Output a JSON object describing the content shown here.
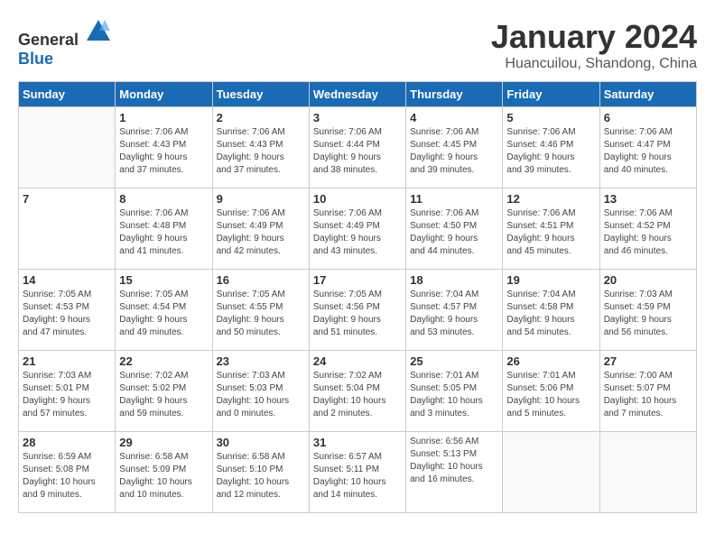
{
  "logo": {
    "text_general": "General",
    "text_blue": "Blue"
  },
  "title": "January 2024",
  "subtitle": "Huancuilou, Shandong, China",
  "days_of_week": [
    "Sunday",
    "Monday",
    "Tuesday",
    "Wednesday",
    "Thursday",
    "Friday",
    "Saturday"
  ],
  "weeks": [
    [
      {
        "day": "",
        "info": ""
      },
      {
        "day": "1",
        "info": "Sunrise: 7:06 AM\nSunset: 4:43 PM\nDaylight: 9 hours\nand 37 minutes."
      },
      {
        "day": "2",
        "info": "Sunrise: 7:06 AM\nSunset: 4:43 PM\nDaylight: 9 hours\nand 37 minutes."
      },
      {
        "day": "3",
        "info": "Sunrise: 7:06 AM\nSunset: 4:44 PM\nDaylight: 9 hours\nand 38 minutes."
      },
      {
        "day": "4",
        "info": "Sunrise: 7:06 AM\nSunset: 4:45 PM\nDaylight: 9 hours\nand 39 minutes."
      },
      {
        "day": "5",
        "info": "Sunrise: 7:06 AM\nSunset: 4:46 PM\nDaylight: 9 hours\nand 39 minutes."
      },
      {
        "day": "6",
        "info": "Sunrise: 7:06 AM\nSunset: 4:47 PM\nDaylight: 9 hours\nand 40 minutes."
      }
    ],
    [
      {
        "day": "7",
        "info": ""
      },
      {
        "day": "8",
        "info": "Sunrise: 7:06 AM\nSunset: 4:48 PM\nDaylight: 9 hours\nand 41 minutes."
      },
      {
        "day": "9",
        "info": "Sunrise: 7:06 AM\nSunset: 4:49 PM\nDaylight: 9 hours\nand 42 minutes."
      },
      {
        "day": "10",
        "info": "Sunrise: 7:06 AM\nSunset: 4:49 PM\nDaylight: 9 hours\nand 43 minutes."
      },
      {
        "day": "11",
        "info": "Sunrise: 7:06 AM\nSunset: 4:50 PM\nDaylight: 9 hours\nand 44 minutes."
      },
      {
        "day": "12",
        "info": "Sunrise: 7:06 AM\nSunset: 4:51 PM\nDaylight: 9 hours\nand 45 minutes."
      },
      {
        "day": "13",
        "info": "Sunrise: 7:06 AM\nSunset: 4:52 PM\nDaylight: 9 hours\nand 46 minutes."
      }
    ],
    [
      {
        "day": "14",
        "info": "Sunrise: 7:05 AM\nSunset: 4:53 PM\nDaylight: 9 hours\nand 47 minutes."
      },
      {
        "day": "15",
        "info": "Sunrise: 7:05 AM\nSunset: 4:54 PM\nDaylight: 9 hours\nand 49 minutes."
      },
      {
        "day": "16",
        "info": "Sunrise: 7:05 AM\nSunset: 4:55 PM\nDaylight: 9 hours\nand 50 minutes."
      },
      {
        "day": "17",
        "info": "Sunrise: 7:05 AM\nSunset: 4:56 PM\nDaylight: 9 hours\nand 51 minutes."
      },
      {
        "day": "18",
        "info": "Sunrise: 7:04 AM\nSunset: 4:57 PM\nDaylight: 9 hours\nand 53 minutes."
      },
      {
        "day": "19",
        "info": "Sunrise: 7:04 AM\nSunset: 4:58 PM\nDaylight: 9 hours\nand 54 minutes."
      },
      {
        "day": "20",
        "info": "Sunrise: 7:03 AM\nSunset: 4:59 PM\nDaylight: 9 hours\nand 56 minutes."
      }
    ],
    [
      {
        "day": "21",
        "info": "Sunrise: 7:03 AM\nSunset: 5:01 PM\nDaylight: 9 hours\nand 57 minutes."
      },
      {
        "day": "22",
        "info": "Sunrise: 7:02 AM\nSunset: 5:02 PM\nDaylight: 9 hours\nand 59 minutes."
      },
      {
        "day": "23",
        "info": "Sunrise: 7:03 AM\nSunset: 5:03 PM\nDaylight: 10 hours\nand 0 minutes."
      },
      {
        "day": "24",
        "info": "Sunrise: 7:02 AM\nSunset: 5:04 PM\nDaylight: 10 hours\nand 2 minutes."
      },
      {
        "day": "25",
        "info": "Sunrise: 7:01 AM\nSunset: 5:05 PM\nDaylight: 10 hours\nand 3 minutes."
      },
      {
        "day": "26",
        "info": "Sunrise: 7:01 AM\nSunset: 5:06 PM\nDaylight: 10 hours\nand 5 minutes."
      },
      {
        "day": "27",
        "info": "Sunrise: 7:00 AM\nSunset: 5:07 PM\nDaylight: 10 hours\nand 7 minutes."
      }
    ],
    [
      {
        "day": "28",
        "info": "Sunrise: 6:59 AM\nSunset: 5:08 PM\nDaylight: 10 hours\nand 9 minutes."
      },
      {
        "day": "29",
        "info": "Sunrise: 6:58 AM\nSunset: 5:09 PM\nDaylight: 10 hours\nand 10 minutes."
      },
      {
        "day": "30",
        "info": "Sunrise: 6:58 AM\nSunset: 5:10 PM\nDaylight: 10 hours\nand 12 minutes."
      },
      {
        "day": "31",
        "info": "Sunrise: 6:57 AM\nSunset: 5:11 PM\nDaylight: 10 hours\nand 14 minutes."
      },
      {
        "day": "",
        "info": "Sunrise: 6:56 AM\nSunset: 5:13 PM\nDaylight: 10 hours\nand 16 minutes."
      },
      {
        "day": "",
        "info": ""
      },
      {
        "day": "",
        "info": ""
      }
    ]
  ]
}
